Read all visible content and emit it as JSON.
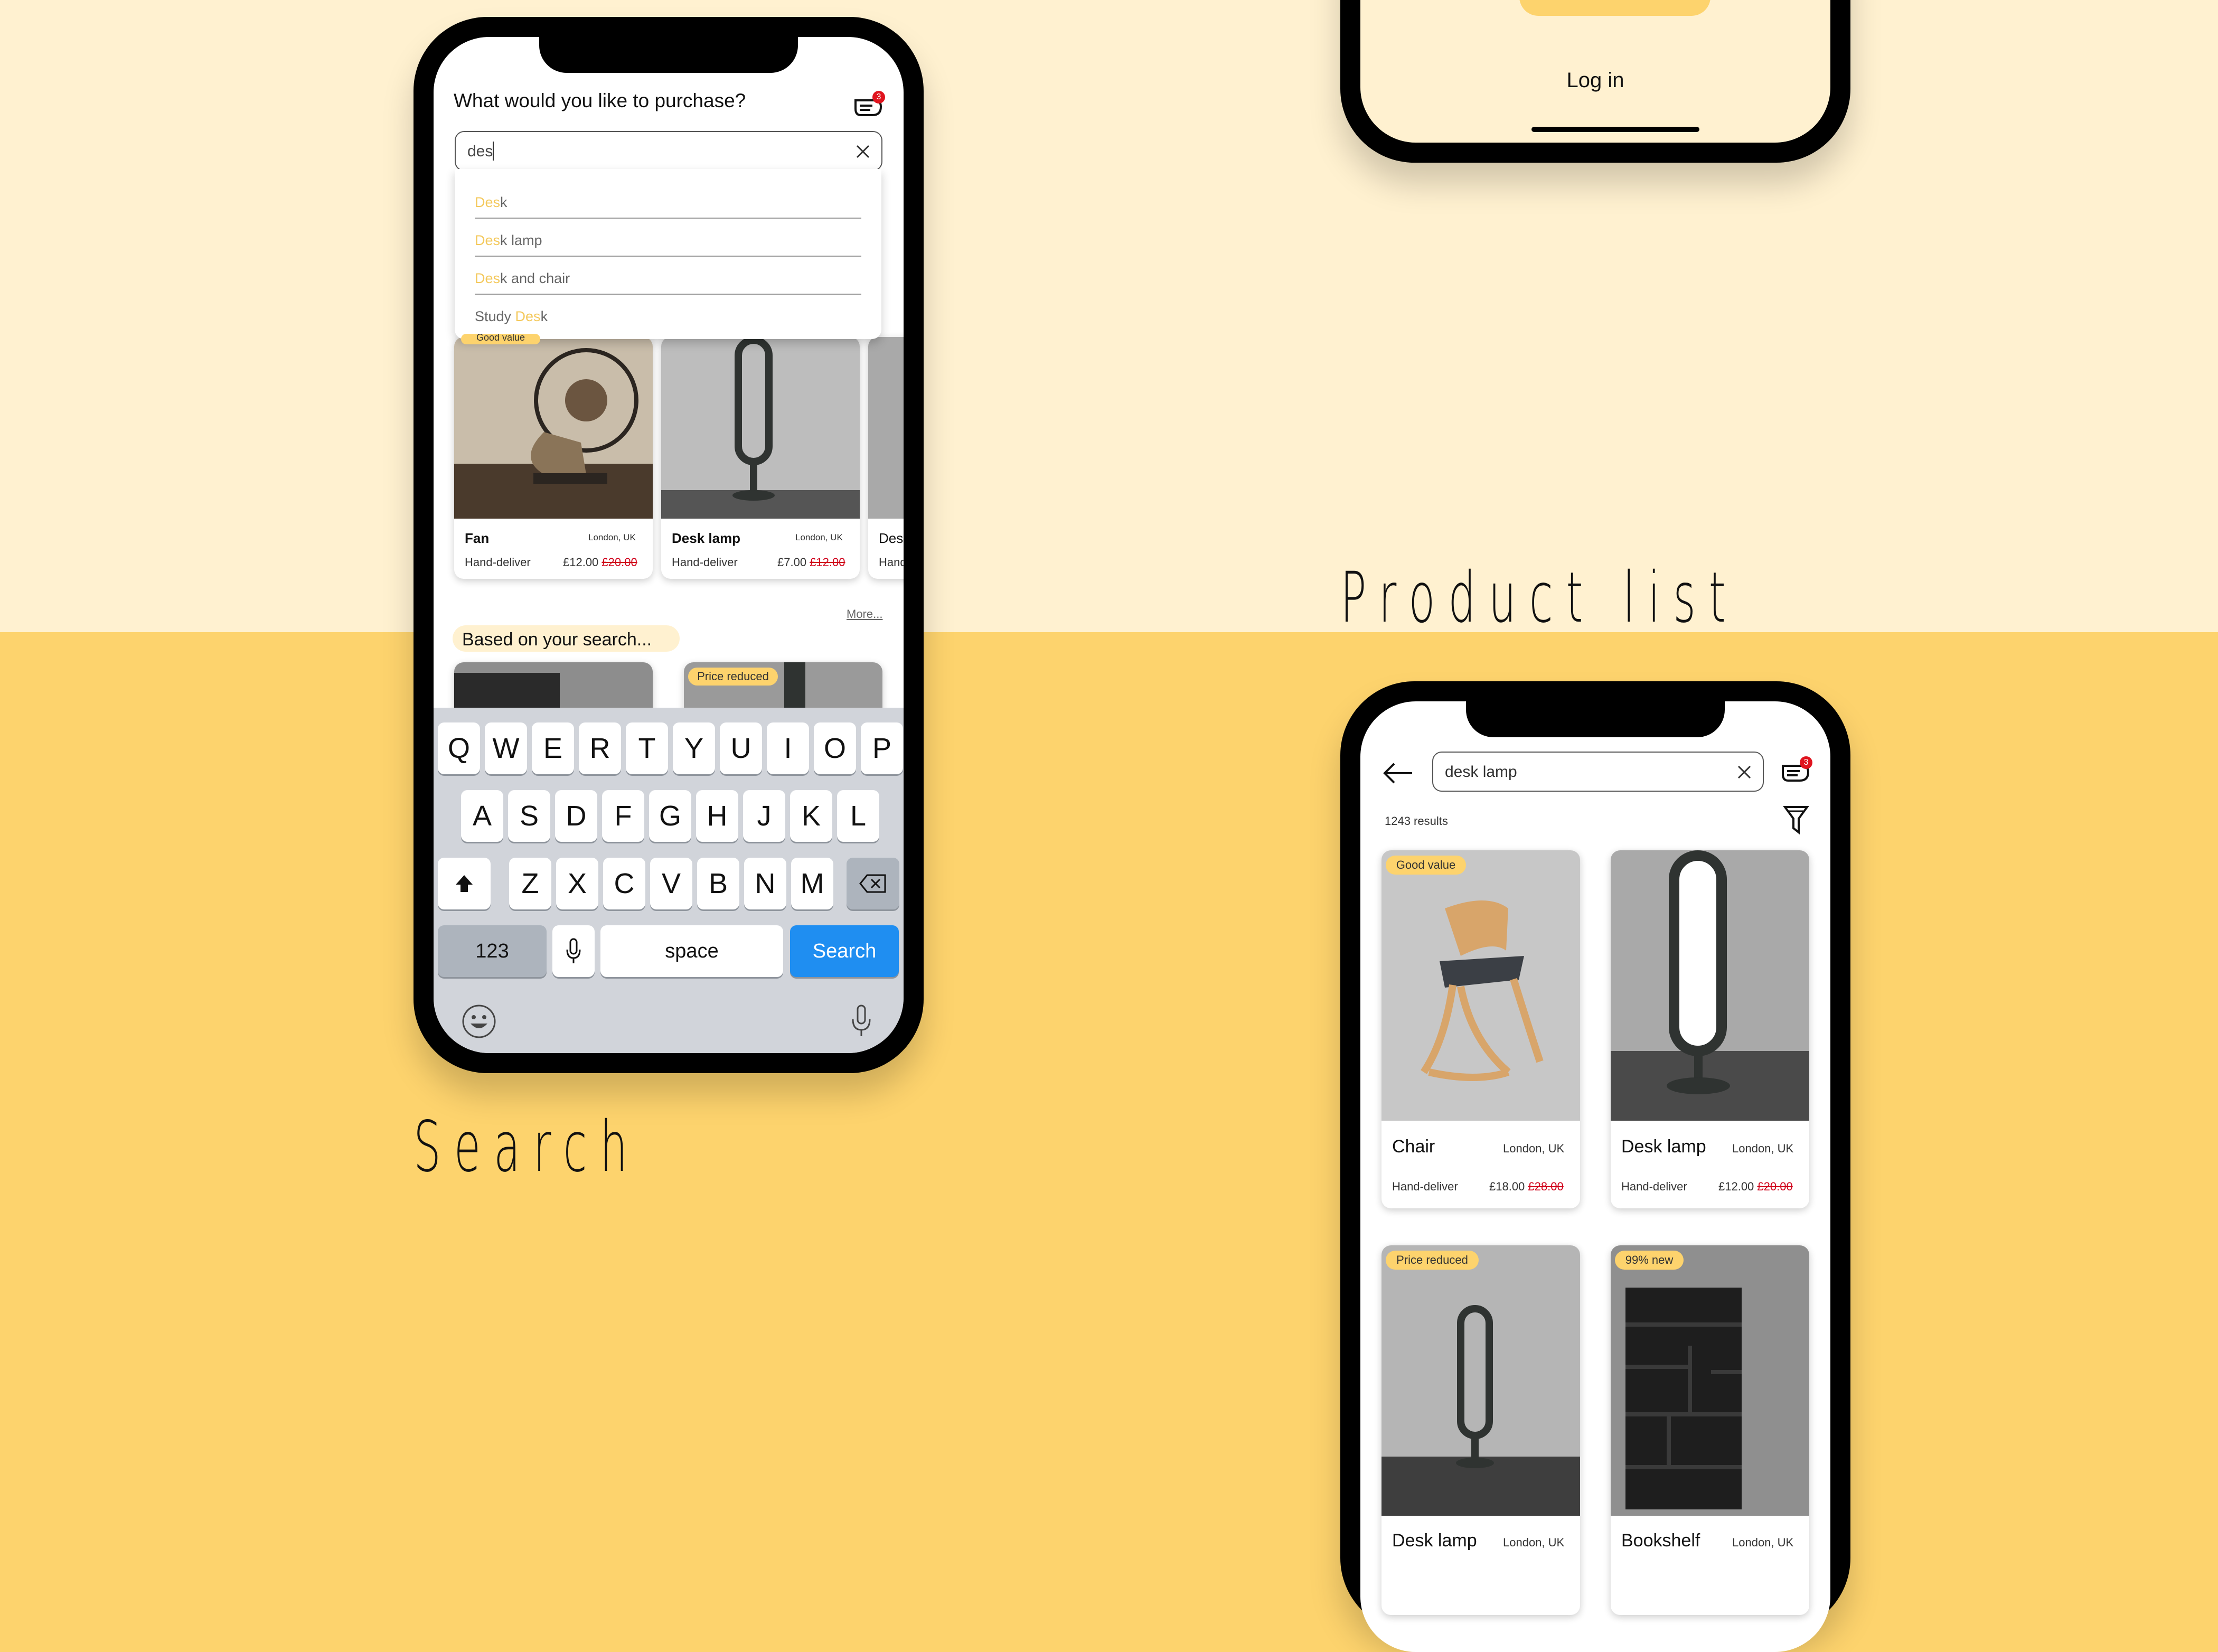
{
  "colors": {
    "background_light": "#fff1d0",
    "background_yellow": "#fdd36d",
    "accent": "#fdd36d",
    "search_key": "#1f8ef1",
    "notification": "#e0141e"
  },
  "sections": {
    "search_title": "Search",
    "product_list_title": "Product list"
  },
  "login_phone": {
    "login_link": "Log in"
  },
  "search_screen": {
    "prompt": "What would you like to purchase?",
    "cart_badge_count": "3",
    "search_value": "des",
    "suggestions": [
      {
        "prefix": "",
        "match": "Des",
        "suffix": "k"
      },
      {
        "prefix": "",
        "match": "Des",
        "suffix": "k lamp"
      },
      {
        "prefix": "",
        "match": "Des",
        "suffix": "k and chair"
      },
      {
        "prefix": "Study ",
        "match": "Des",
        "suffix": "k"
      }
    ],
    "hidden_badge": "Good value",
    "products": [
      {
        "name": "Fan",
        "location": "London, UK",
        "delivery": "Hand-deliver",
        "price": "£12.00",
        "old_price": "£20.00",
        "icon": "fan-photo"
      },
      {
        "name": "Desk lamp",
        "location": "London, UK",
        "delivery": "Hand-deliver",
        "price": "£7.00",
        "old_price": "£12.00",
        "icon": "desk-lamp-photo"
      },
      {
        "name": "Des",
        "location": "",
        "delivery": "Hand",
        "price": "",
        "old_price": "",
        "icon": "partial-card"
      }
    ],
    "more_link": "More...",
    "based_on_label": "Based on your search...",
    "price_reduced_badge": "Price reduced",
    "keyboard": {
      "row1": [
        "Q",
        "W",
        "E",
        "R",
        "T",
        "Y",
        "U",
        "I",
        "O",
        "P"
      ],
      "row2": [
        "A",
        "S",
        "D",
        "F",
        "G",
        "H",
        "J",
        "K",
        "L"
      ],
      "row3": [
        "Z",
        "X",
        "C",
        "V",
        "B",
        "N",
        "M"
      ],
      "numbers_key": "123",
      "space_key": "space",
      "search_key": "Search"
    }
  },
  "product_list_screen": {
    "search_value": "desk lamp",
    "cart_badge_count": "3",
    "results_count": "1243 results",
    "products": [
      {
        "badge": "Good value",
        "name": "Chair",
        "location": "London, UK",
        "delivery": "Hand-deliver",
        "price": "£18.00",
        "old_price": "£28.00"
      },
      {
        "badge": "",
        "name": "Desk lamp",
        "location": "London, UK",
        "delivery": "Hand-deliver",
        "price": "£12.00",
        "old_price": "£20.00"
      },
      {
        "badge": "Price reduced",
        "name": "Desk lamp",
        "location": "London, UK"
      },
      {
        "badge": "99% new",
        "name": "Bookshelf",
        "location": "London, UK"
      }
    ]
  }
}
